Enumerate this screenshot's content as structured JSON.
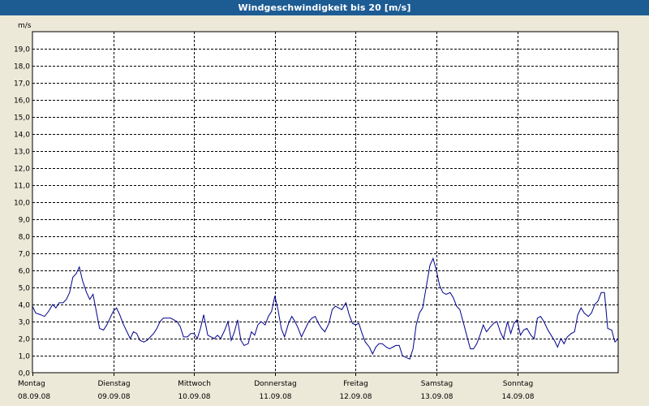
{
  "window": {
    "title": "Windgeschwindigkeit bis 20 [m/s]"
  },
  "chart_data": {
    "type": "line",
    "title": "Windgeschwindigkeit bis 20 [m/s]",
    "ylabel": "m/s",
    "ylim": [
      0,
      20
    ],
    "grid": true,
    "colors": {
      "line": "#00008b",
      "grid": "#000000",
      "background": "#ffffff",
      "frame": "#ece9d8"
    },
    "y_ticks": [
      "0,0",
      "1,0",
      "2,0",
      "3,0",
      "4,0",
      "5,0",
      "6,0",
      "7,0",
      "8,0",
      "9,0",
      "10,0",
      "11,0",
      "12,0",
      "13,0",
      "14,0",
      "15,0",
      "16,0",
      "17,0",
      "18,0",
      "19,0"
    ],
    "x_ticks": [
      {
        "day": "Montag",
        "date": "08.09.08"
      },
      {
        "day": "Dienstag",
        "date": "09.09.08"
      },
      {
        "day": "Mittwoch",
        "date": "10.09.08"
      },
      {
        "day": "Donnerstag",
        "date": "11.09.08"
      },
      {
        "day": "Freitag",
        "date": "12.09.08"
      },
      {
        "day": "Samstag",
        "date": "13.09.08"
      },
      {
        "day": "Sonntag",
        "date": "14.09.08"
      }
    ],
    "x_unit": "days since 08.09.08 00:00",
    "series": [
      {
        "name": "",
        "points": [
          [
            0.0,
            3.9
          ],
          [
            0.04,
            3.5
          ],
          [
            0.1,
            3.4
          ],
          [
            0.15,
            3.3
          ],
          [
            0.2,
            3.6
          ],
          [
            0.25,
            4.0
          ],
          [
            0.29,
            3.8
          ],
          [
            0.33,
            4.1
          ],
          [
            0.38,
            4.1
          ],
          [
            0.42,
            4.3
          ],
          [
            0.46,
            4.7
          ],
          [
            0.5,
            5.6
          ],
          [
            0.54,
            5.8
          ],
          [
            0.58,
            6.2
          ],
          [
            0.62,
            5.4
          ],
          [
            0.67,
            4.7
          ],
          [
            0.71,
            4.3
          ],
          [
            0.75,
            4.6
          ],
          [
            0.79,
            3.6
          ],
          [
            0.83,
            2.6
          ],
          [
            0.88,
            2.5
          ],
          [
            0.92,
            2.8
          ],
          [
            0.96,
            3.2
          ],
          [
            1.0,
            3.6
          ],
          [
            1.04,
            3.8
          ],
          [
            1.08,
            3.4
          ],
          [
            1.12,
            2.9
          ],
          [
            1.17,
            2.4
          ],
          [
            1.21,
            2.0
          ],
          [
            1.25,
            2.4
          ],
          [
            1.29,
            2.3
          ],
          [
            1.33,
            1.9
          ],
          [
            1.38,
            1.8
          ],
          [
            1.42,
            1.9
          ],
          [
            1.46,
            2.1
          ],
          [
            1.5,
            2.3
          ],
          [
            1.54,
            2.6
          ],
          [
            1.58,
            3.0
          ],
          [
            1.62,
            3.2
          ],
          [
            1.67,
            3.2
          ],
          [
            1.71,
            3.2
          ],
          [
            1.75,
            3.1
          ],
          [
            1.79,
            3.0
          ],
          [
            1.83,
            2.7
          ],
          [
            1.87,
            2.1
          ],
          [
            1.92,
            2.1
          ],
          [
            1.96,
            2.3
          ],
          [
            2.0,
            2.3
          ],
          [
            2.04,
            2.0
          ],
          [
            2.08,
            2.6
          ],
          [
            2.12,
            3.4
          ],
          [
            2.17,
            2.2
          ],
          [
            2.21,
            2.1
          ],
          [
            2.25,
            2.0
          ],
          [
            2.29,
            2.2
          ],
          [
            2.33,
            2.0
          ],
          [
            2.38,
            2.5
          ],
          [
            2.42,
            3.0
          ],
          [
            2.46,
            1.9
          ],
          [
            2.5,
            2.4
          ],
          [
            2.54,
            3.1
          ],
          [
            2.58,
            1.9
          ],
          [
            2.62,
            1.6
          ],
          [
            2.67,
            1.7
          ],
          [
            2.71,
            2.4
          ],
          [
            2.75,
            2.2
          ],
          [
            2.79,
            2.8
          ],
          [
            2.83,
            3.0
          ],
          [
            2.88,
            2.8
          ],
          [
            2.92,
            3.3
          ],
          [
            2.96,
            3.6
          ],
          [
            3.0,
            4.5
          ],
          [
            3.04,
            3.7
          ],
          [
            3.08,
            2.6
          ],
          [
            3.12,
            2.1
          ],
          [
            3.17,
            2.9
          ],
          [
            3.21,
            3.3
          ],
          [
            3.25,
            3.0
          ],
          [
            3.29,
            2.6
          ],
          [
            3.33,
            2.1
          ],
          [
            3.38,
            2.6
          ],
          [
            3.42,
            3.0
          ],
          [
            3.46,
            3.2
          ],
          [
            3.5,
            3.3
          ],
          [
            3.54,
            2.9
          ],
          [
            3.58,
            2.6
          ],
          [
            3.62,
            2.4
          ],
          [
            3.67,
            2.9
          ],
          [
            3.71,
            3.7
          ],
          [
            3.75,
            3.9
          ],
          [
            3.79,
            3.8
          ],
          [
            3.83,
            3.7
          ],
          [
            3.88,
            4.1
          ],
          [
            3.92,
            3.4
          ],
          [
            3.96,
            2.9
          ],
          [
            4.0,
            2.8
          ],
          [
            4.04,
            2.9
          ],
          [
            4.08,
            2.3
          ],
          [
            4.12,
            1.8
          ],
          [
            4.17,
            1.5
          ],
          [
            4.21,
            1.1
          ],
          [
            4.25,
            1.5
          ],
          [
            4.29,
            1.7
          ],
          [
            4.33,
            1.7
          ],
          [
            4.38,
            1.5
          ],
          [
            4.42,
            1.4
          ],
          [
            4.46,
            1.5
          ],
          [
            4.5,
            1.6
          ],
          [
            4.54,
            1.6
          ],
          [
            4.58,
            1.0
          ],
          [
            4.62,
            0.9
          ],
          [
            4.67,
            0.8
          ],
          [
            4.71,
            1.4
          ],
          [
            4.75,
            2.8
          ],
          [
            4.79,
            3.5
          ],
          [
            4.83,
            3.8
          ],
          [
            4.88,
            5.2
          ],
          [
            4.92,
            6.3
          ],
          [
            4.96,
            6.7
          ],
          [
            5.0,
            6.0
          ],
          [
            5.04,
            5.1
          ],
          [
            5.08,
            4.7
          ],
          [
            5.12,
            4.6
          ],
          [
            5.17,
            4.7
          ],
          [
            5.21,
            4.4
          ],
          [
            5.25,
            3.9
          ],
          [
            5.29,
            3.7
          ],
          [
            5.33,
            3.0
          ],
          [
            5.38,
            2.1
          ],
          [
            5.42,
            1.4
          ],
          [
            5.46,
            1.4
          ],
          [
            5.5,
            1.7
          ],
          [
            5.54,
            2.2
          ],
          [
            5.58,
            2.8
          ],
          [
            5.62,
            2.4
          ],
          [
            5.67,
            2.7
          ],
          [
            5.71,
            2.9
          ],
          [
            5.75,
            3.0
          ],
          [
            5.79,
            2.4
          ],
          [
            5.83,
            2.0
          ],
          [
            5.88,
            3.0
          ],
          [
            5.92,
            2.3
          ],
          [
            5.96,
            2.9
          ],
          [
            6.0,
            3.1
          ],
          [
            6.04,
            2.2
          ],
          [
            6.08,
            2.5
          ],
          [
            6.12,
            2.6
          ],
          [
            6.17,
            2.2
          ],
          [
            6.21,
            2.0
          ],
          [
            6.25,
            3.2
          ],
          [
            6.29,
            3.3
          ],
          [
            6.33,
            3.0
          ],
          [
            6.38,
            2.5
          ],
          [
            6.42,
            2.2
          ],
          [
            6.46,
            1.9
          ],
          [
            6.5,
            1.5
          ],
          [
            6.54,
            2.0
          ],
          [
            6.58,
            1.7
          ],
          [
            6.62,
            2.1
          ],
          [
            6.67,
            2.3
          ],
          [
            6.71,
            2.4
          ],
          [
            6.75,
            3.4
          ],
          [
            6.79,
            3.8
          ],
          [
            6.83,
            3.5
          ],
          [
            6.88,
            3.3
          ],
          [
            6.92,
            3.5
          ],
          [
            6.96,
            4.0
          ],
          [
            7.0,
            4.2
          ],
          [
            7.04,
            4.7
          ],
          [
            7.08,
            4.7
          ],
          [
            7.12,
            2.6
          ],
          [
            7.17,
            2.5
          ],
          [
            7.21,
            1.8
          ],
          [
            7.25,
            2.0
          ]
        ]
      }
    ]
  }
}
